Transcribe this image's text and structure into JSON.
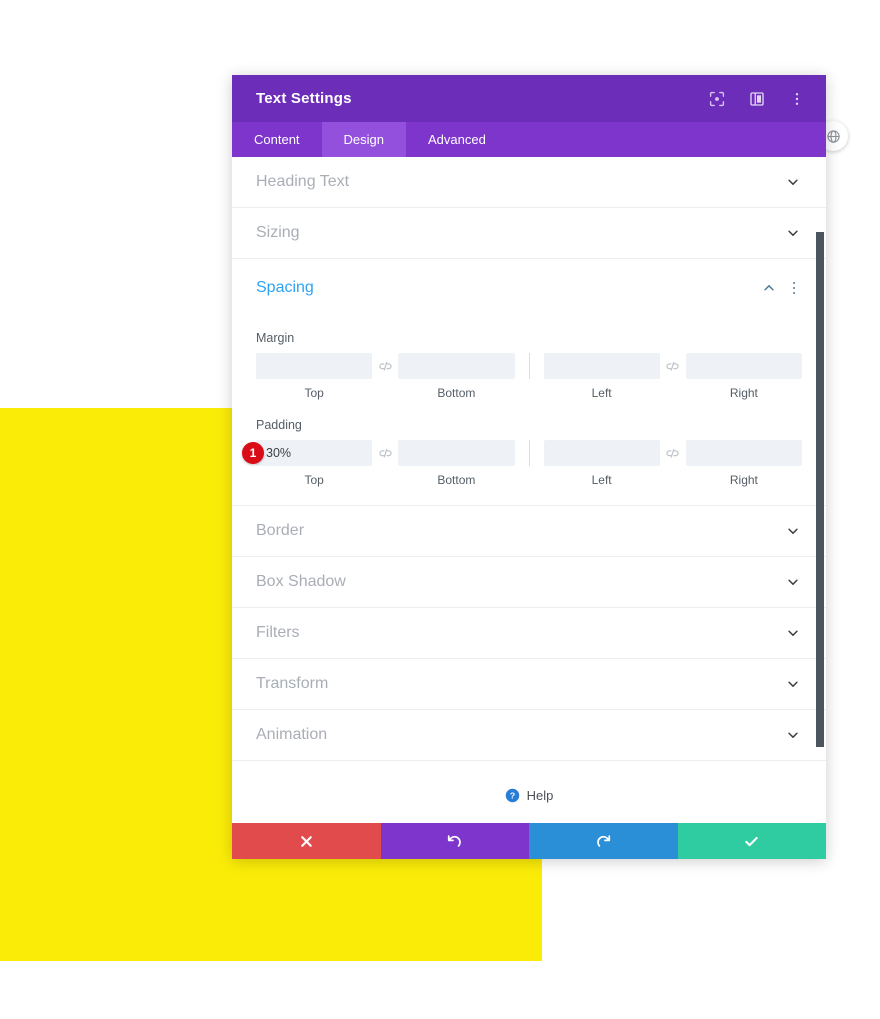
{
  "canvas": {
    "yellow_block_color": "#FBEC08",
    "background_color": "#FFFFFF"
  },
  "floating": {
    "globe_button_name": "globe-icon"
  },
  "modal": {
    "title": "Text Settings",
    "titlebar_color": "#6C2EB9",
    "tabbar_color": "#7D35CC",
    "active_tab_color": "#9350DD",
    "titlebar_icons": [
      {
        "name": "focus-target-icon",
        "label": "Focus"
      },
      {
        "name": "layout-panel-icon",
        "label": "Panel Layout"
      },
      {
        "name": "more-vertical-icon",
        "label": "More Options"
      }
    ],
    "tabs": [
      {
        "label": "Content",
        "active": false
      },
      {
        "label": "Design",
        "active": true
      },
      {
        "label": "Advanced",
        "active": false
      }
    ],
    "accordions_above": [
      {
        "label": "Heading Text",
        "open": false
      },
      {
        "label": "Sizing",
        "open": false
      }
    ],
    "spacing": {
      "label": "Spacing",
      "open": true,
      "accent_color": "#2EA3F2",
      "groups": [
        {
          "title": "Margin",
          "fields": [
            {
              "label": "Top",
              "value": "",
              "marker": null
            },
            {
              "label": "Bottom",
              "value": "",
              "marker": null
            },
            {
              "label": "Left",
              "value": "",
              "marker": null
            },
            {
              "label": "Right",
              "value": "",
              "marker": null
            }
          ]
        },
        {
          "title": "Padding",
          "fields": [
            {
              "label": "Top",
              "value": "30%",
              "marker": "1"
            },
            {
              "label": "Bottom",
              "value": "",
              "marker": null
            },
            {
              "label": "Left",
              "value": "",
              "marker": null
            },
            {
              "label": "Right",
              "value": "",
              "marker": null
            }
          ]
        }
      ],
      "link_icon_name": "unlink-icon"
    },
    "accordions_below": [
      {
        "label": "Border",
        "open": false
      },
      {
        "label": "Box Shadow",
        "open": false
      },
      {
        "label": "Filters",
        "open": false
      },
      {
        "label": "Transform",
        "open": false
      },
      {
        "label": "Animation",
        "open": false
      }
    ],
    "help": {
      "label": "Help",
      "icon_name": "help-circle-icon",
      "icon_color": "#2A7DD6"
    },
    "footer_buttons": [
      {
        "name": "cancel-button",
        "icon": "close-icon",
        "color": "#E24B4B"
      },
      {
        "name": "undo-button",
        "icon": "undo-icon",
        "color": "#7D35CC"
      },
      {
        "name": "redo-button",
        "icon": "redo-icon",
        "color": "#2A8FD6"
      },
      {
        "name": "save-button",
        "icon": "check-icon",
        "color": "#2ECCA0"
      }
    ]
  },
  "markers": [
    {
      "id": "1",
      "target": "padding-top-input",
      "color": "#D90C17"
    }
  ]
}
